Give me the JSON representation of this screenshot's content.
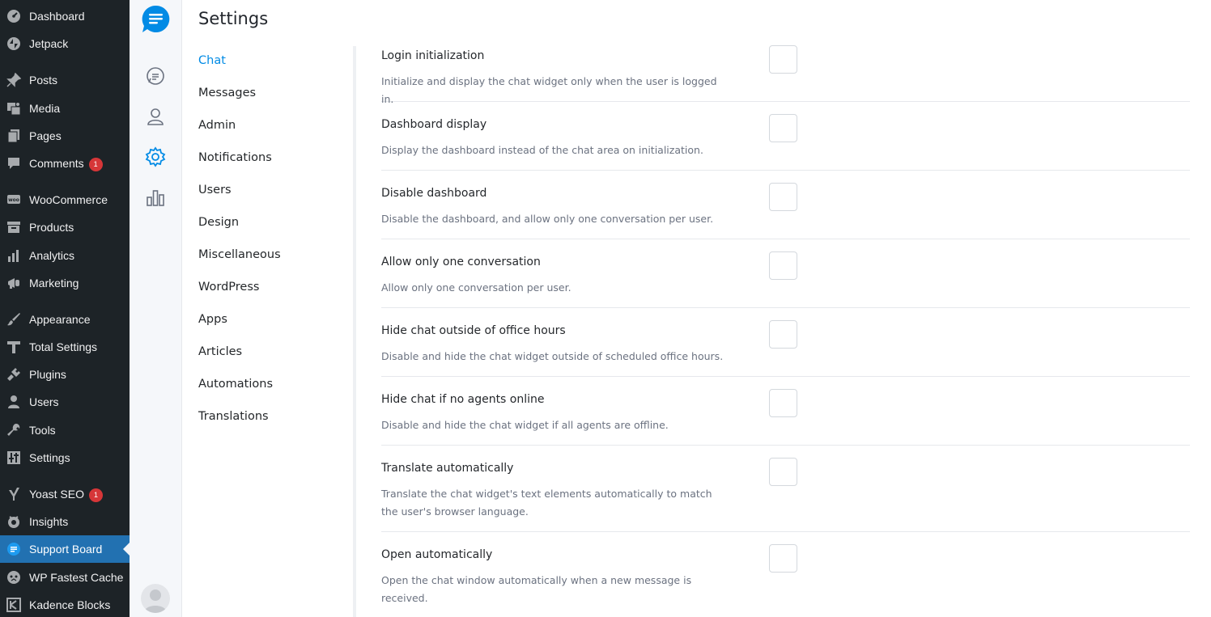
{
  "wp_menu": [
    {
      "label": "Dashboard",
      "icon": "dashboard-icon"
    },
    {
      "label": "Jetpack",
      "icon": "jetpack-icon"
    },
    {
      "label": "Posts",
      "icon": "pin-icon"
    },
    {
      "label": "Media",
      "icon": "media-icon"
    },
    {
      "label": "Pages",
      "icon": "pages-icon"
    },
    {
      "label": "Comments",
      "icon": "comment-icon",
      "badge": "1"
    },
    {
      "label": "WooCommerce",
      "icon": "woo-icon"
    },
    {
      "label": "Products",
      "icon": "archive-icon"
    },
    {
      "label": "Analytics",
      "icon": "bar-chart-icon"
    },
    {
      "label": "Marketing",
      "icon": "megaphone-icon"
    },
    {
      "label": "Appearance",
      "icon": "paintbrush-icon"
    },
    {
      "label": "Total Settings",
      "icon": "total-settings-icon"
    },
    {
      "label": "Plugins",
      "icon": "plug-icon"
    },
    {
      "label": "Users",
      "icon": "user-icon"
    },
    {
      "label": "Tools",
      "icon": "wrench-icon"
    },
    {
      "label": "Settings",
      "icon": "sliders-icon"
    },
    {
      "label": "Yoast SEO",
      "icon": "yoast-icon",
      "badge": "1"
    },
    {
      "label": "Insights",
      "icon": "insights-icon"
    },
    {
      "label": "Support Board",
      "icon": "support-board-icon",
      "active": true
    },
    {
      "label": "WP Fastest Cache",
      "icon": "cheetah-icon"
    },
    {
      "label": "Kadence Blocks",
      "icon": "kadence-icon"
    }
  ],
  "rail": {
    "icons": [
      "support-board-logo",
      "conversations-icon",
      "users-icon",
      "settings-icon",
      "reports-icon",
      "agent-avatar"
    ],
    "accent": "#028be5"
  },
  "page": {
    "title": "Settings"
  },
  "settings_nav": [
    "Chat",
    "Messages",
    "Admin",
    "Notifications",
    "Users",
    "Design",
    "Miscellaneous",
    "WordPress",
    "Apps",
    "Articles",
    "Automations",
    "Translations"
  ],
  "settings_nav_active": "Chat",
  "settings": [
    {
      "title": "Login initialization",
      "description": "Initialize and display the chat widget only when the user is logged in.",
      "checked": false
    },
    {
      "title": "Dashboard display",
      "description": "Display the dashboard instead of the chat area on initialization.",
      "checked": false
    },
    {
      "title": "Disable dashboard",
      "description": "Disable the dashboard, and allow only one conversation per user.",
      "checked": false
    },
    {
      "title": "Allow only one conversation",
      "description": "Allow only one conversation per user.",
      "checked": false
    },
    {
      "title": "Hide chat outside of office hours",
      "description": "Disable and hide the chat widget outside of scheduled office hours.",
      "checked": false
    },
    {
      "title": "Hide chat if no agents online",
      "description": "Disable and hide the chat widget if all agents are offline.",
      "checked": false
    },
    {
      "title": "Translate automatically",
      "description": "Translate the chat widget's text elements automatically to match the user's browser language.",
      "checked": false
    },
    {
      "title": "Open automatically",
      "description": "Open the chat window automatically when a new message is received.",
      "checked": false
    }
  ],
  "colors": {
    "wp_sidebar": "#1d2327",
    "wp_active": "#2271b1",
    "badge": "#d63638",
    "accent": "#028be5"
  }
}
